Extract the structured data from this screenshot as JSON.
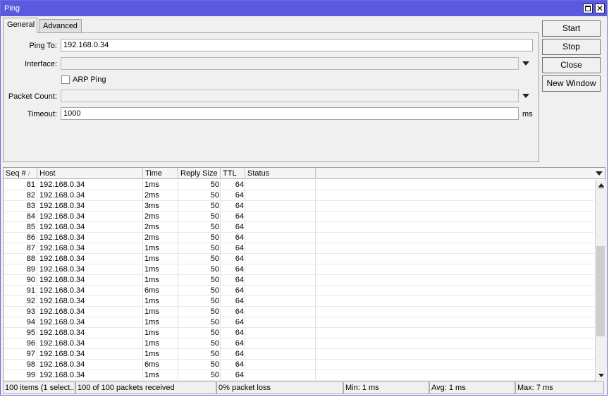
{
  "window": {
    "title": "Ping"
  },
  "tabs": [
    {
      "label": "General"
    },
    {
      "label": "Advanced"
    }
  ],
  "form": {
    "ping_to_label": "Ping To:",
    "ping_to_value": "192.168.0.34",
    "interface_label": "Interface:",
    "interface_value": "",
    "arp_ping_label": "ARP Ping",
    "arp_ping_checked": false,
    "packet_count_label": "Packet Count:",
    "packet_count_value": "",
    "timeout_label": "Timeout:",
    "timeout_value": "1000",
    "timeout_unit": "ms"
  },
  "buttons": {
    "start": "Start",
    "stop": "Stop",
    "close": "Close",
    "new_window": "New Window"
  },
  "table": {
    "headers": {
      "seq": "Seq #",
      "host": "Host",
      "time": "Time",
      "reply_size": "Reply Size",
      "ttl": "TTL",
      "status": "Status"
    },
    "sort_indicator": "/",
    "rows": [
      {
        "seq": "81",
        "host": "192.168.0.34",
        "time": "1ms",
        "size": "50",
        "ttl": "64",
        "status": ""
      },
      {
        "seq": "82",
        "host": "192.168.0.34",
        "time": "2ms",
        "size": "50",
        "ttl": "64",
        "status": ""
      },
      {
        "seq": "83",
        "host": "192.168.0.34",
        "time": "3ms",
        "size": "50",
        "ttl": "64",
        "status": ""
      },
      {
        "seq": "84",
        "host": "192.168.0.34",
        "time": "2ms",
        "size": "50",
        "ttl": "64",
        "status": ""
      },
      {
        "seq": "85",
        "host": "192.168.0.34",
        "time": "2ms",
        "size": "50",
        "ttl": "64",
        "status": ""
      },
      {
        "seq": "86",
        "host": "192.168.0.34",
        "time": "2ms",
        "size": "50",
        "ttl": "64",
        "status": ""
      },
      {
        "seq": "87",
        "host": "192.168.0.34",
        "time": "1ms",
        "size": "50",
        "ttl": "64",
        "status": ""
      },
      {
        "seq": "88",
        "host": "192.168.0.34",
        "time": "1ms",
        "size": "50",
        "ttl": "64",
        "status": ""
      },
      {
        "seq": "89",
        "host": "192.168.0.34",
        "time": "1ms",
        "size": "50",
        "ttl": "64",
        "status": ""
      },
      {
        "seq": "90",
        "host": "192.168.0.34",
        "time": "1ms",
        "size": "50",
        "ttl": "64",
        "status": ""
      },
      {
        "seq": "91",
        "host": "192.168.0.34",
        "time": "6ms",
        "size": "50",
        "ttl": "64",
        "status": ""
      },
      {
        "seq": "92",
        "host": "192.168.0.34",
        "time": "1ms",
        "size": "50",
        "ttl": "64",
        "status": ""
      },
      {
        "seq": "93",
        "host": "192.168.0.34",
        "time": "1ms",
        "size": "50",
        "ttl": "64",
        "status": ""
      },
      {
        "seq": "94",
        "host": "192.168.0.34",
        "time": "1ms",
        "size": "50",
        "ttl": "64",
        "status": ""
      },
      {
        "seq": "95",
        "host": "192.168.0.34",
        "time": "1ms",
        "size": "50",
        "ttl": "64",
        "status": ""
      },
      {
        "seq": "96",
        "host": "192.168.0.34",
        "time": "1ms",
        "size": "50",
        "ttl": "64",
        "status": ""
      },
      {
        "seq": "97",
        "host": "192.168.0.34",
        "time": "1ms",
        "size": "50",
        "ttl": "64",
        "status": ""
      },
      {
        "seq": "98",
        "host": "192.168.0.34",
        "time": "6ms",
        "size": "50",
        "ttl": "64",
        "status": ""
      },
      {
        "seq": "99",
        "host": "192.168.0.34",
        "time": "1ms",
        "size": "50",
        "ttl": "64",
        "status": ""
      }
    ]
  },
  "statusbar": {
    "items": "100 items (1 select...",
    "received": "100 of 100 packets received",
    "loss": "0% packet loss",
    "min": "Min: 1 ms",
    "avg": "Avg: 1 ms",
    "max": "Max: 7 ms"
  },
  "colors": {
    "titlebar": "#5a5ae0",
    "window_bg": "#f0f0f0"
  }
}
